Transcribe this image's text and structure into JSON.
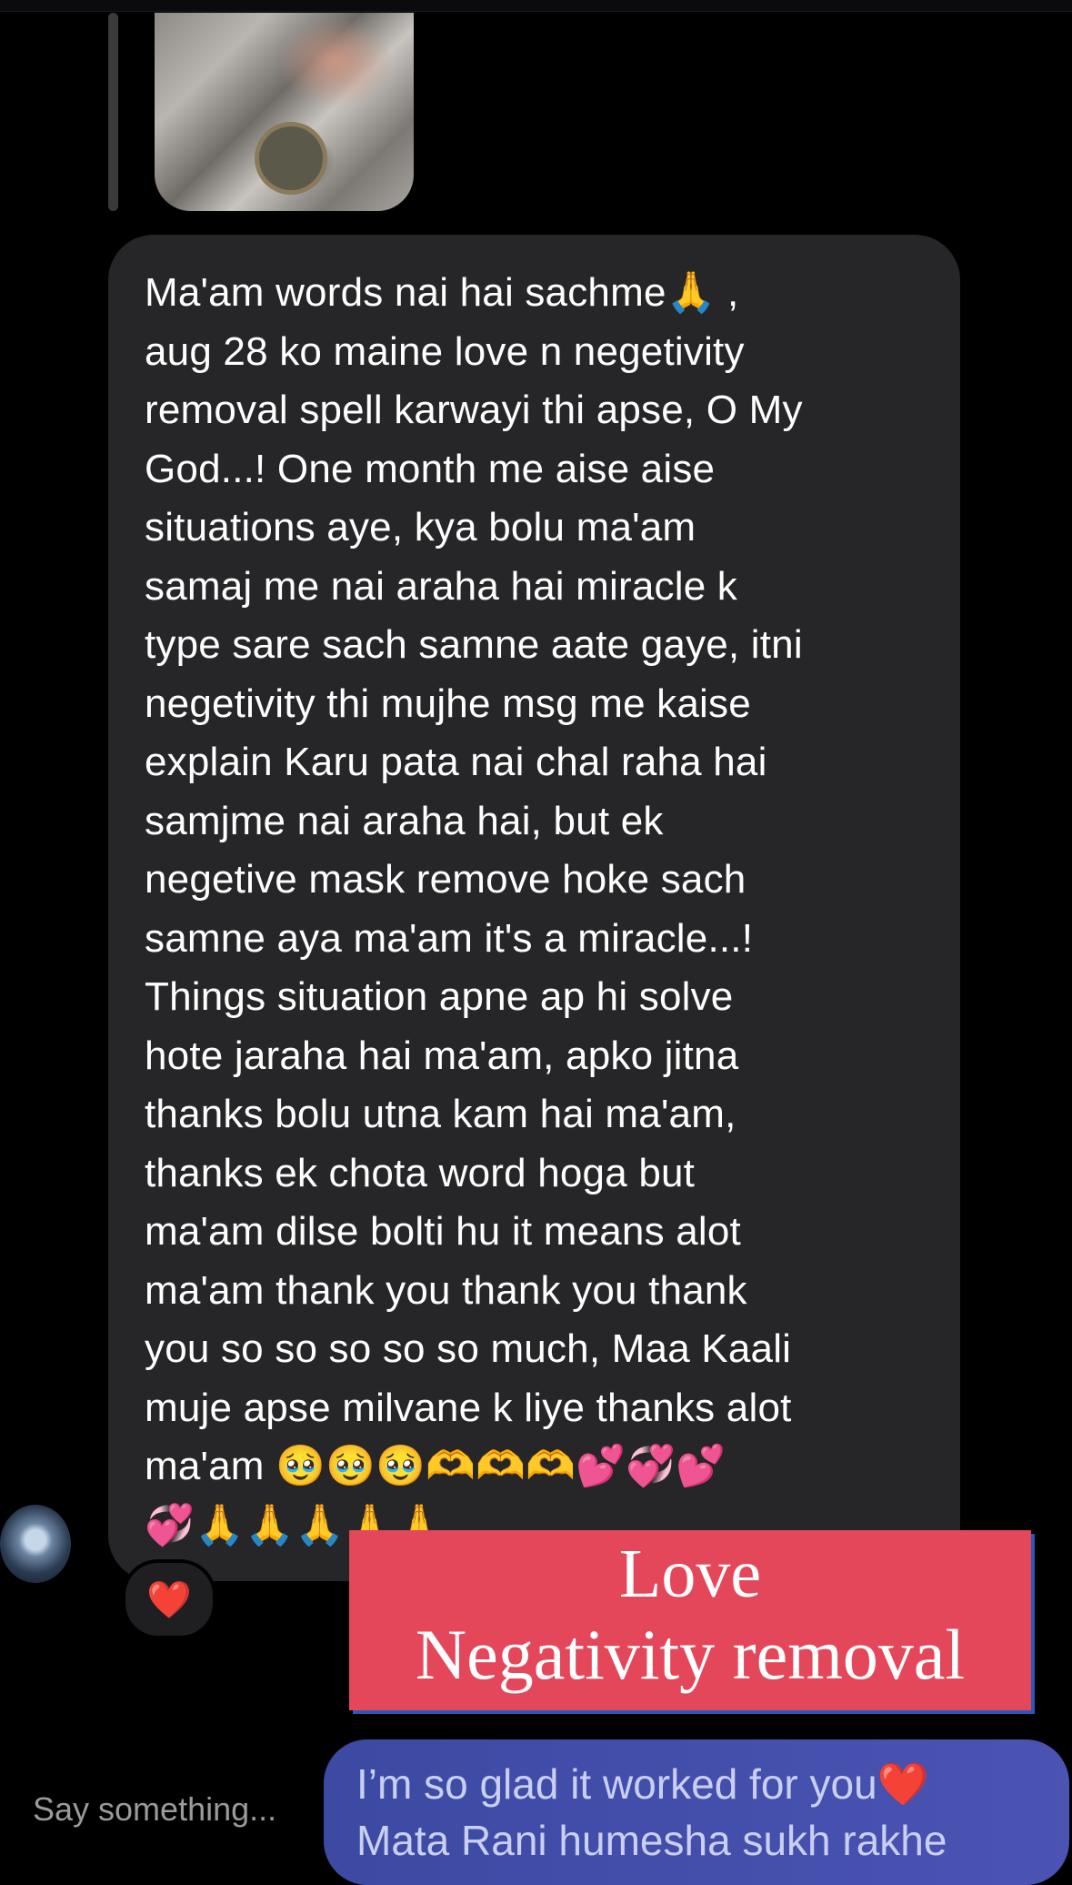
{
  "conversation": {
    "incoming_message": "Ma'am words nai hai sachme🙏 ,\naug 28 ko maine love n negetivity\nremoval spell karwayi thi apse, O My\nGod...! One month me aise aise\nsituations aye, kya bolu ma'am\nsamaj me nai araha hai miracle k\ntype sare sach samne aate gaye, itni\nnegetivity thi mujhe msg me kaise\nexplain Karu pata nai chal raha hai\nsamjme nai araha hai, but ek\nnegetive mask remove hoke sach\nsamne aya ma'am it's a miracle...!\nThings situation apne ap hi solve\nhote jaraha hai ma'am, apko jitna\nthanks bolu utna kam hai ma'am,\nthanks ek chota word hoga but\nma'am dilse bolti hu it means alot\nma'am thank you thank you thank\nyou so so so so so much, Maa Kaali\nmuje apse milvane k liye thanks alot\nma'am 🥹🥹🥹🫶🫶🫶💕💞💕\n💞🙏🙏🙏🙏🙏",
    "reaction": "❤️",
    "outgoing_line1": "I’m so glad it worked for you",
    "outgoing_heart": "❤️",
    "outgoing_line2": "Mata Rani humesha sukh rakhe"
  },
  "overlay": {
    "line1": "Love",
    "line2": "Negativity removal"
  },
  "composer": {
    "placeholder": "Say something..."
  },
  "colors": {
    "background": "#000000",
    "incoming_bubble": "#262628",
    "outgoing_bubble": "#4450ab",
    "overlay_banner": "#e4475a"
  },
  "icons": {
    "reaction": "heart-icon",
    "avatar": "user-avatar"
  }
}
